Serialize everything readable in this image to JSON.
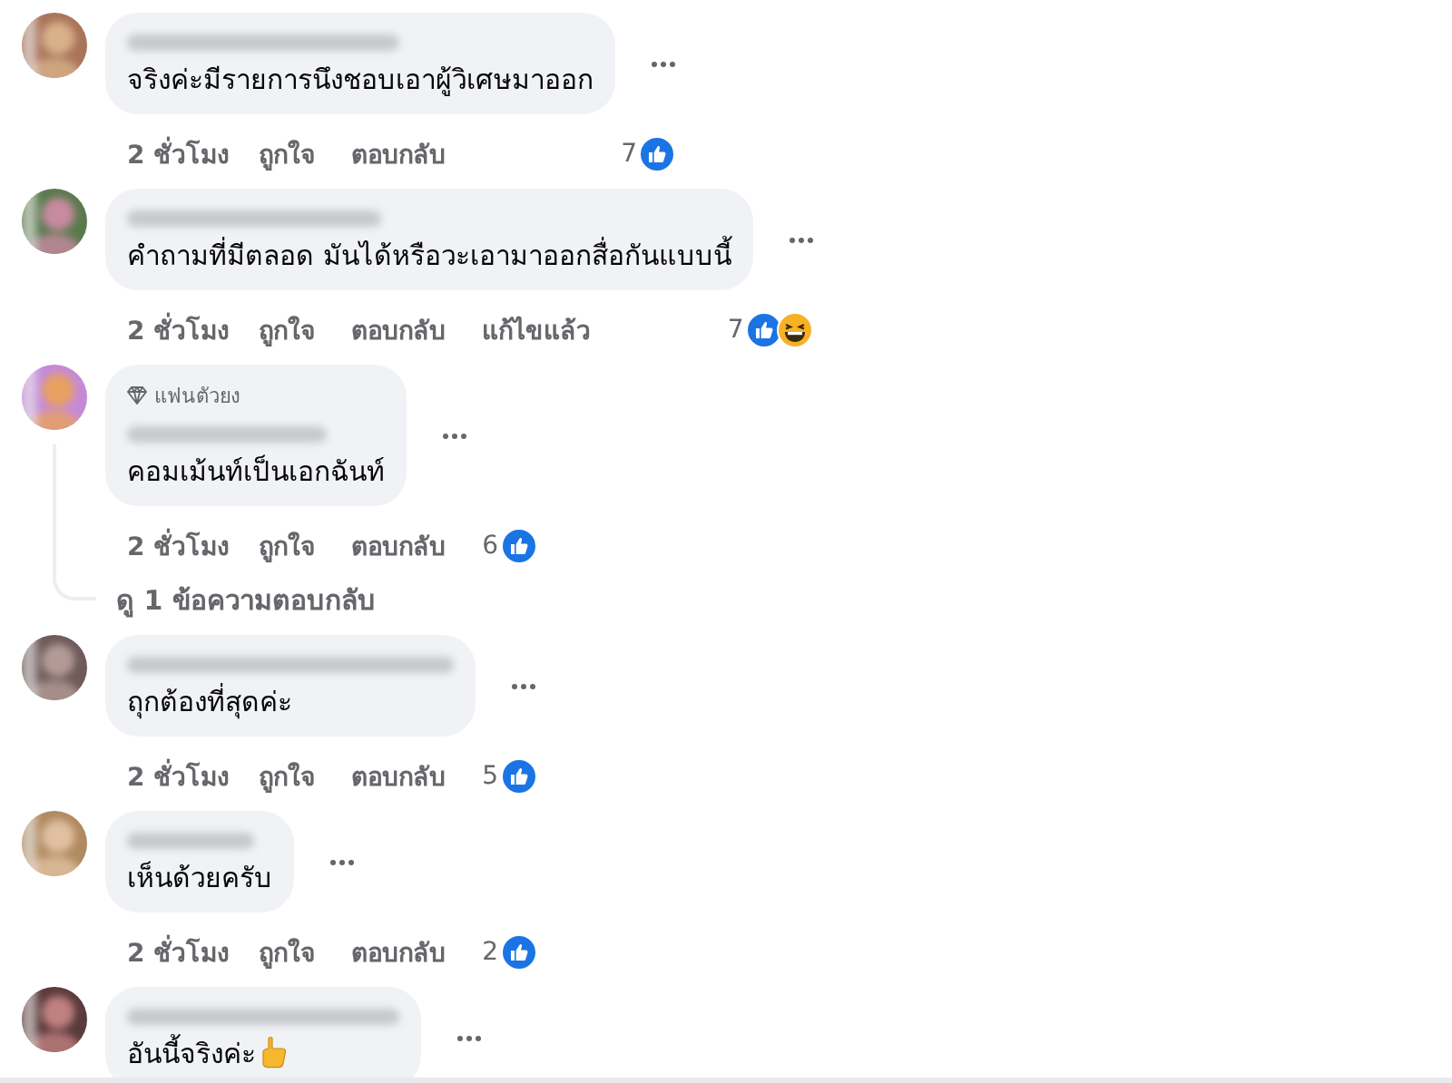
{
  "comments": [
    {
      "text": "จริงค่ะมีรายการนึงชอบเอาผู้วิเศษมาออก",
      "time": "2 ชั่วโมง",
      "like": "ถูกใจ",
      "reply": "ตอบกลับ",
      "reaction_count": "7",
      "reactions": [
        {
          "kind": "like"
        }
      ]
    },
    {
      "text": "คำถามที่มีตลอด มันได้หรือวะเอามาออกสื่อกันแบบนี้",
      "time": "2 ชั่วโมง",
      "like": "ถูกใจ",
      "reply": "ตอบกลับ",
      "edited": "แก้ไขแล้ว",
      "reaction_count": "7",
      "reactions": [
        {
          "kind": "like"
        },
        {
          "kind": "haha"
        }
      ]
    },
    {
      "badge": "แฟนตัวยง",
      "text": "คอมเม้นท์เป็นเอกฉันท์",
      "time": "2 ชั่วโมง",
      "like": "ถูกใจ",
      "reply": "ตอบกลับ",
      "reaction_count": "6",
      "reactions": [
        {
          "kind": "like"
        }
      ],
      "replies_link": "ดู 1 ข้อความตอบกลับ"
    },
    {
      "text": "ถุกต้องที่สุดค่ะ",
      "time": "2 ชั่วโมง",
      "like": "ถูกใจ",
      "reply": "ตอบกลับ",
      "reaction_count": "5",
      "reactions": [
        {
          "kind": "like"
        }
      ]
    },
    {
      "text": "เห็นด้วยครับ",
      "time": "2 ชั่วโมง",
      "like": "ถูกใจ",
      "reply": "ตอบกลับ",
      "reaction_count": "2",
      "reactions": [
        {
          "kind": "like"
        }
      ]
    },
    {
      "text": "อันนี้จริงค่ะ",
      "text_icon": {
        "kind": "thumbs-up"
      }
    }
  ]
}
